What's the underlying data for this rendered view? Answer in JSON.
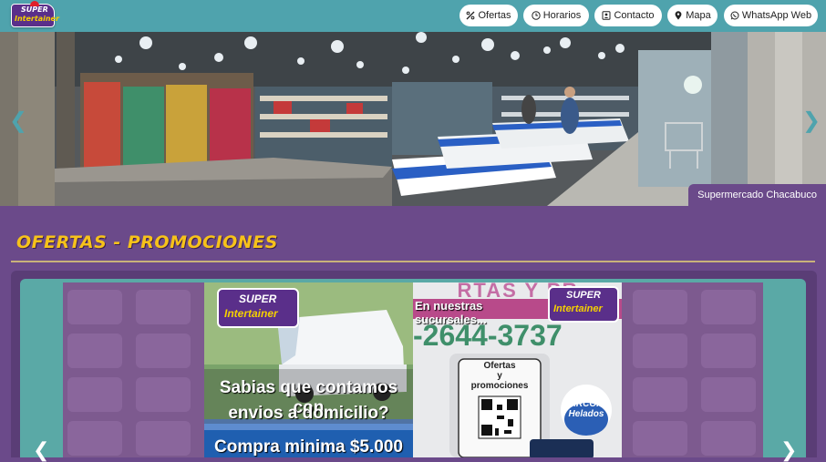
{
  "brand": {
    "logo_line1": "SUPER",
    "logo_line2": "Intertainer"
  },
  "nav": {
    "ofertas": "Ofertas",
    "horarios": "Horarios",
    "contacto": "Contacto",
    "mapa": "Mapa",
    "whatsapp": "WhatsApp Web"
  },
  "hero": {
    "caption": "Supermercado Chacabuco",
    "prev": "❮",
    "next": "❯"
  },
  "section": {
    "title": "OFERTAS - PROMOCIONES"
  },
  "carousel": {
    "prev": "❮",
    "next": "❯",
    "flyer1": {
      "logo_line1": "SUPER",
      "logo_line2": "Intertainer",
      "text1": "Sabias que contamos con",
      "text2": "envios a domicilio?",
      "text3": "Compra minima $5.000"
    },
    "flyer2": {
      "top_text": "RTAS Y PR",
      "banner": "En nuestras sucursales...",
      "logo_line1": "SUPER",
      "logo_line2": "Intertainer",
      "phone": "-2644-3737",
      "card_line1": "Ofertas",
      "card_line2": "y",
      "card_line3": "promociones",
      "brand_badge": "ARCOR",
      "brand_badge2": "Helados"
    }
  },
  "colors": {
    "navbar": "#4fa3ad",
    "page_bg": "#6b4a8a",
    "title": "#f6c21a",
    "carousel_bg": "#5aa9a6"
  }
}
